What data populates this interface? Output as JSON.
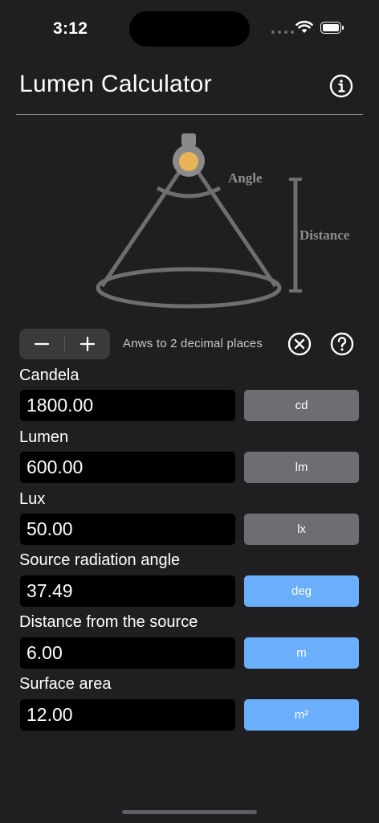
{
  "status": {
    "time": "3:12"
  },
  "header": {
    "title": "Lumen Calculator"
  },
  "illustration": {
    "angle_label": "Angle",
    "distance_label": "Distance"
  },
  "controls": {
    "minus": "−",
    "plus": "+",
    "hint": "Anws to 2 decimal places"
  },
  "fields": [
    {
      "label": "Candela",
      "value": "1800.00",
      "unit": "cd"
    },
    {
      "label": "Lumen",
      "value": "600.00",
      "unit": "lm"
    },
    {
      "label": "Lux",
      "value": "50.00",
      "unit": "lx"
    },
    {
      "label": "Source radiation angle",
      "value": "37.49",
      "unit": "deg"
    },
    {
      "label": "Distance from the source",
      "value": "6.00",
      "unit": "m"
    },
    {
      "label": "Surface area",
      "value": "12.00",
      "unit": "m²"
    }
  ],
  "colors": {
    "background": "#1f1f21",
    "input_bg": "#000000",
    "unit_gray": "#6e6e72",
    "unit_blue": "#6aaefc",
    "bulb": "#e8b455"
  }
}
